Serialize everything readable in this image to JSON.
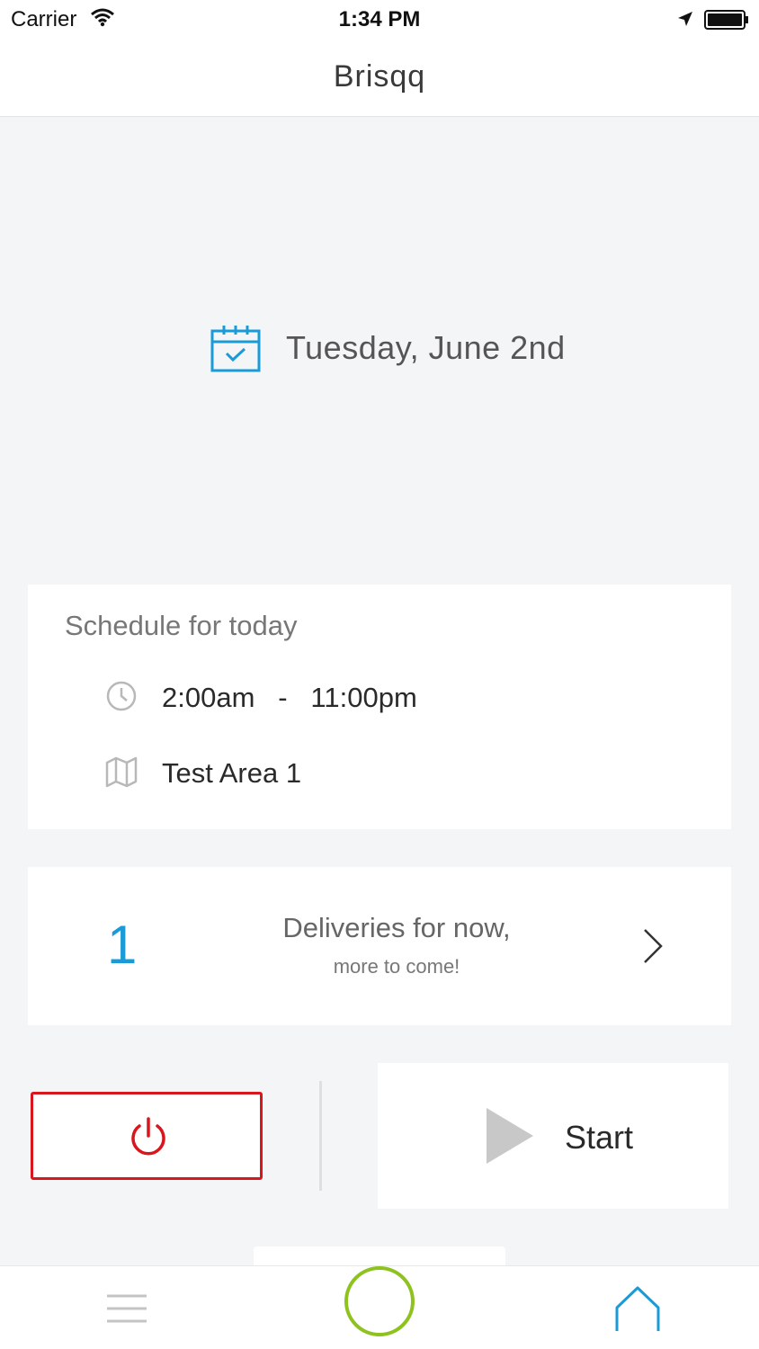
{
  "status_bar": {
    "carrier": "Carrier",
    "time": "1:34 PM"
  },
  "nav": {
    "title": "Brisqq"
  },
  "date": {
    "text": "Tuesday, June 2nd",
    "icon": "calendar-check-icon"
  },
  "schedule": {
    "heading": "Schedule for today",
    "start_time": "2:00am",
    "separator": "-",
    "end_time": "11:00pm",
    "area": "Test Area 1"
  },
  "deliveries": {
    "count": "1",
    "line1": "Deliveries for now,",
    "line2": "more to come!"
  },
  "actions": {
    "start_label": "Start"
  },
  "tabs": [
    {
      "icon": "menu-icon"
    },
    {
      "icon": "circle-icon"
    },
    {
      "icon": "home-icon"
    }
  ],
  "colors": {
    "accent_blue": "#1a9bd7",
    "power_red": "#d9161c",
    "circle_green": "#8ec21f",
    "background": "#f4f5f7"
  }
}
